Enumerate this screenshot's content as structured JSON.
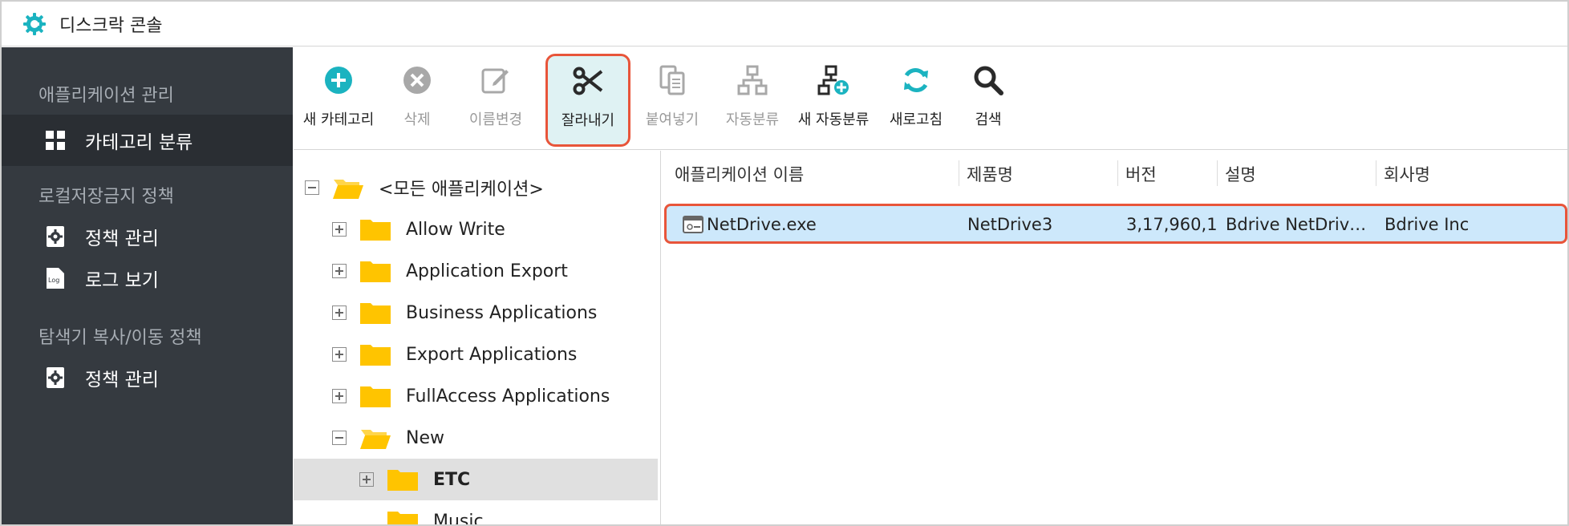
{
  "app": {
    "title": "디스크락 콘솔",
    "accent_color": "#1bb3c0",
    "highlight_color": "#e8553a"
  },
  "sidebar": {
    "sections": [
      {
        "title": "애플리케이션 관리",
        "items": [
          {
            "label": "카테고리 분류",
            "icon": "grid-icon",
            "active": true
          }
        ]
      },
      {
        "title": "로컬저장금지 정책",
        "items": [
          {
            "label": "정책 관리",
            "icon": "gear-doc-icon"
          },
          {
            "label": "로그 보기",
            "icon": "log-doc-icon"
          }
        ]
      },
      {
        "title": "탐색기 복사/이동 정책",
        "items": [
          {
            "label": "정책 관리",
            "icon": "gear-doc-icon"
          }
        ]
      }
    ]
  },
  "toolbar": {
    "buttons": [
      {
        "label": "새 카테고리",
        "icon": "add-circle-icon",
        "enabled": true
      },
      {
        "label": "삭제",
        "icon": "delete-circle-icon",
        "enabled": false
      },
      {
        "label": "이름변경",
        "icon": "edit-icon",
        "enabled": false
      },
      {
        "label": "잘라내기",
        "icon": "scissors-icon",
        "enabled": true,
        "selected": true
      },
      {
        "label": "붙여넣기",
        "icon": "paste-icon",
        "enabled": false
      },
      {
        "label": "자동분류",
        "icon": "hierarchy-icon",
        "enabled": false
      },
      {
        "label": "새 자동분류",
        "icon": "hierarchy-add-icon",
        "enabled": true
      },
      {
        "label": "새로고침",
        "icon": "refresh-icon",
        "enabled": true
      },
      {
        "label": "검색",
        "icon": "search-icon",
        "enabled": true
      }
    ]
  },
  "tree": {
    "nodes": [
      {
        "label": "<모든 애플리케이션>",
        "level": 0,
        "expanded": true
      },
      {
        "label": "Allow Write",
        "level": 1,
        "expanded": false
      },
      {
        "label": "Application Export",
        "level": 1,
        "expanded": false
      },
      {
        "label": "Business Applications",
        "level": 1,
        "expanded": false
      },
      {
        "label": "Export Applications",
        "level": 1,
        "expanded": false
      },
      {
        "label": "FullAccess Applications",
        "level": 1,
        "expanded": false
      },
      {
        "label": "New",
        "level": 1,
        "expanded": true
      },
      {
        "label": "ETC",
        "level": 2,
        "expanded": false,
        "selected": true
      },
      {
        "label": "Music",
        "level": 2,
        "expanded": false,
        "partial": true
      }
    ]
  },
  "list": {
    "columns": [
      "애플리케이션 이름",
      "제품명",
      "버전",
      "설명",
      "회사명"
    ],
    "rows": [
      {
        "name": "NetDrive.exe",
        "product": "NetDrive3",
        "version": "3,17,960,1",
        "description": "Bdrive NetDriv…",
        "company": "Bdrive Inc",
        "selected": true
      }
    ]
  }
}
